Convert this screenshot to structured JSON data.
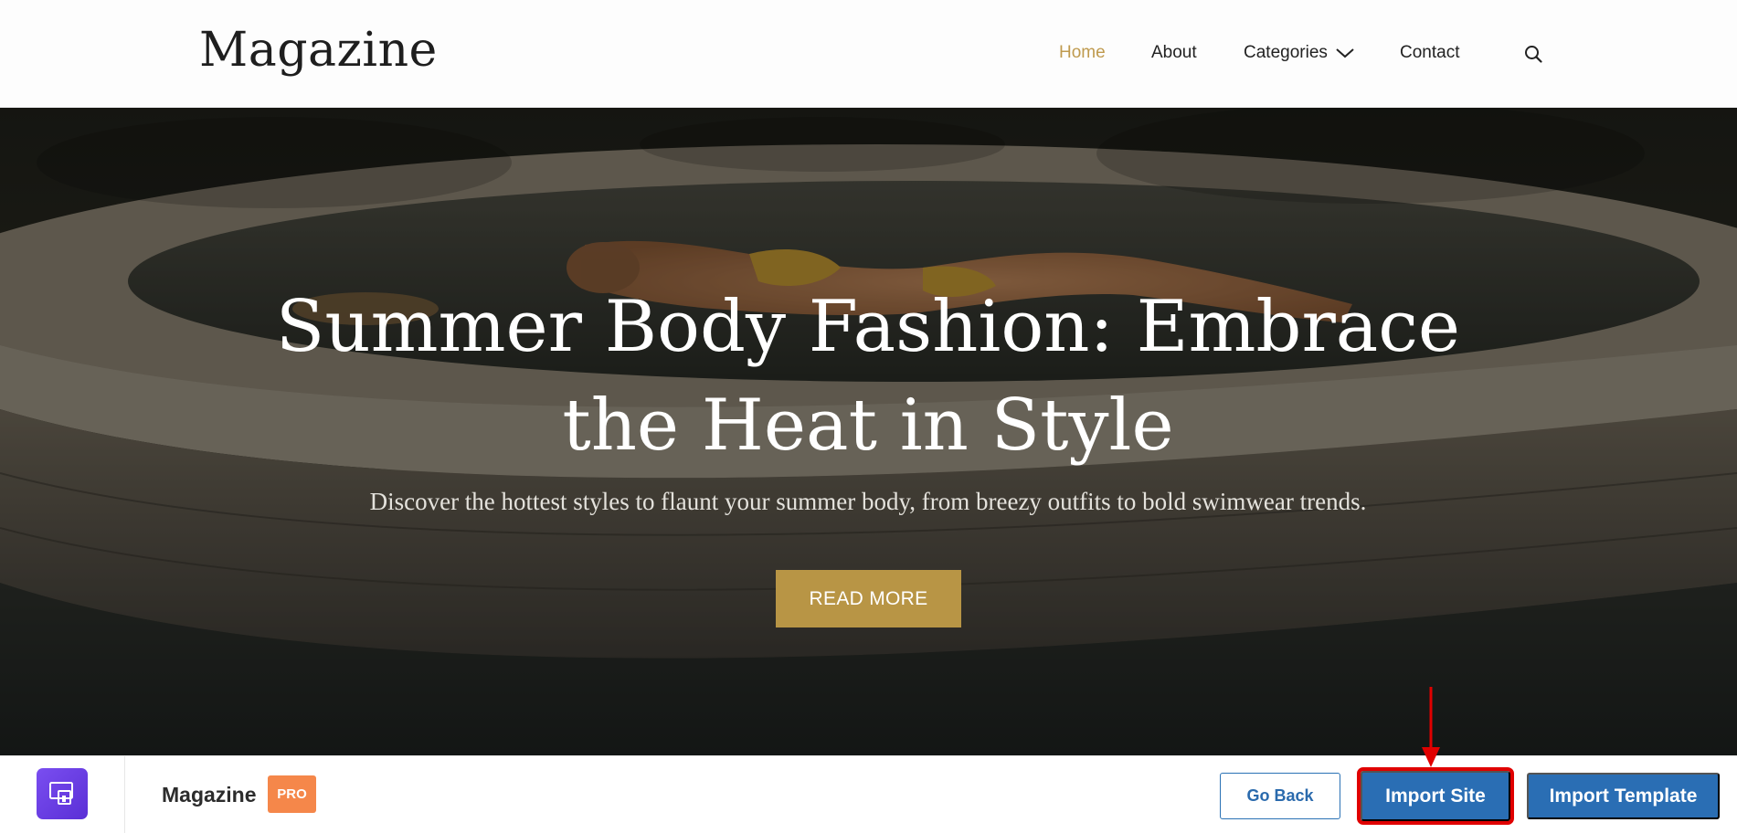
{
  "header": {
    "logo": "Magazine",
    "nav": [
      {
        "label": "Home",
        "active": true
      },
      {
        "label": "About",
        "active": false
      },
      {
        "label": "Categories",
        "active": false,
        "has_dropdown": true
      },
      {
        "label": "Contact",
        "active": false
      }
    ],
    "search_icon": "search-icon",
    "active_color": "#bf9a4e"
  },
  "hero": {
    "title": "Summer Body Fashion: Embrace the Heat in Style",
    "subtitle": "Discover the hottest styles to flaunt your summer body, from breezy outfits to bold swimwear trends.",
    "cta_label": "READ MORE",
    "cta_color": "#b89545"
  },
  "import_bar": {
    "app_icon": "template-kit-icon",
    "title": "Magazine",
    "badge": "PRO",
    "badge_color": "#f5874a",
    "buttons": {
      "go_back": "Go Back",
      "import_site": "Import Site",
      "import_template": "Import Template"
    },
    "button_color": "#2a6eb4",
    "highlight_color": "#e00000"
  }
}
